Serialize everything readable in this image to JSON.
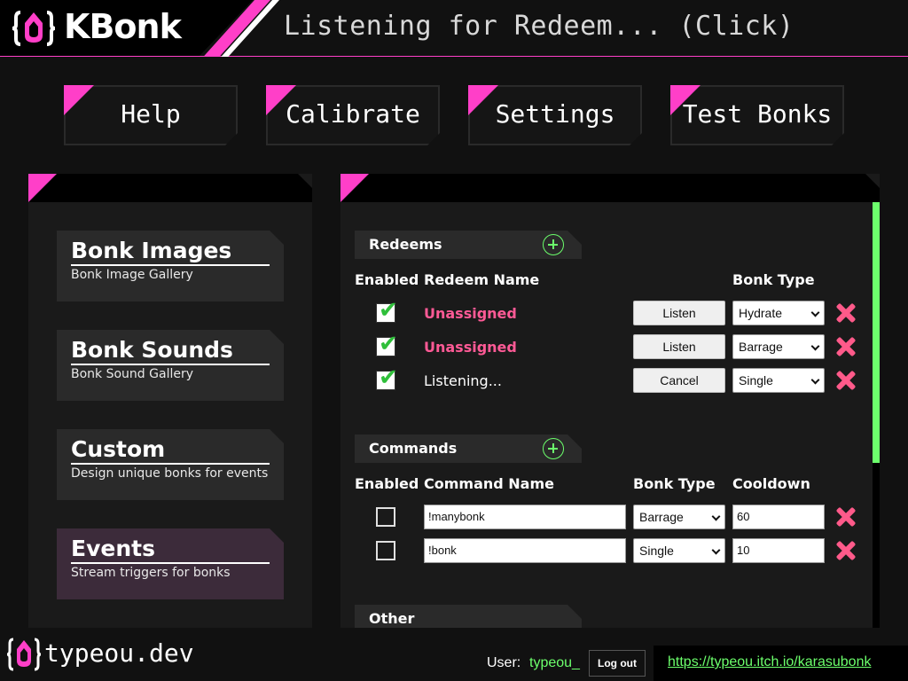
{
  "header": {
    "app_name": "KBonk",
    "logo_icon": "kbonk-logo-icon",
    "status": "Listening for Redeem... (Click)",
    "accent_color": "#ff3fc8"
  },
  "toolbar": {
    "buttons": [
      "Help",
      "Calibrate",
      "Settings",
      "Test Bonks"
    ]
  },
  "nav": {
    "items": [
      {
        "title": "Bonk Images",
        "subtitle": "Bonk Image Gallery"
      },
      {
        "title": "Bonk Sounds",
        "subtitle": "Bonk Sound Gallery"
      },
      {
        "title": "Custom",
        "subtitle": "Design unique bonks for events"
      },
      {
        "title": "Events",
        "subtitle": "Stream triggers for bonks",
        "active": true
      }
    ]
  },
  "redeems": {
    "section_title": "Redeems",
    "add_icon": "plus-circle-icon",
    "columns": {
      "enabled": "Enabled",
      "name": "Redeem Name",
      "bonk_type": "Bonk Type"
    },
    "rows": [
      {
        "enabled": true,
        "name": "Unassigned",
        "action": "Listen",
        "bonk_type": "Hydrate"
      },
      {
        "enabled": true,
        "name": "Unassigned",
        "action": "Listen",
        "bonk_type": "Barrage"
      },
      {
        "enabled": true,
        "name": "Listening...",
        "action": "Cancel",
        "bonk_type": "Single"
      }
    ]
  },
  "commands": {
    "section_title": "Commands",
    "add_icon": "plus-circle-icon",
    "columns": {
      "enabled": "Enabled",
      "name": "Command Name",
      "bonk_type": "Bonk Type",
      "cooldown": "Cooldown"
    },
    "rows": [
      {
        "enabled": false,
        "name": "!manybonk",
        "bonk_type": "Barrage",
        "cooldown": "60"
      },
      {
        "enabled": false,
        "name": "!bonk",
        "bonk_type": "Single",
        "cooldown": "10"
      }
    ]
  },
  "other": {
    "section_title": "Other"
  },
  "footer": {
    "brand": "typeou.dev",
    "user_label": "User:",
    "user_name": "typeou_",
    "logout_label": "Log out",
    "link": "https://typeou.itch.io/karasubonk"
  }
}
